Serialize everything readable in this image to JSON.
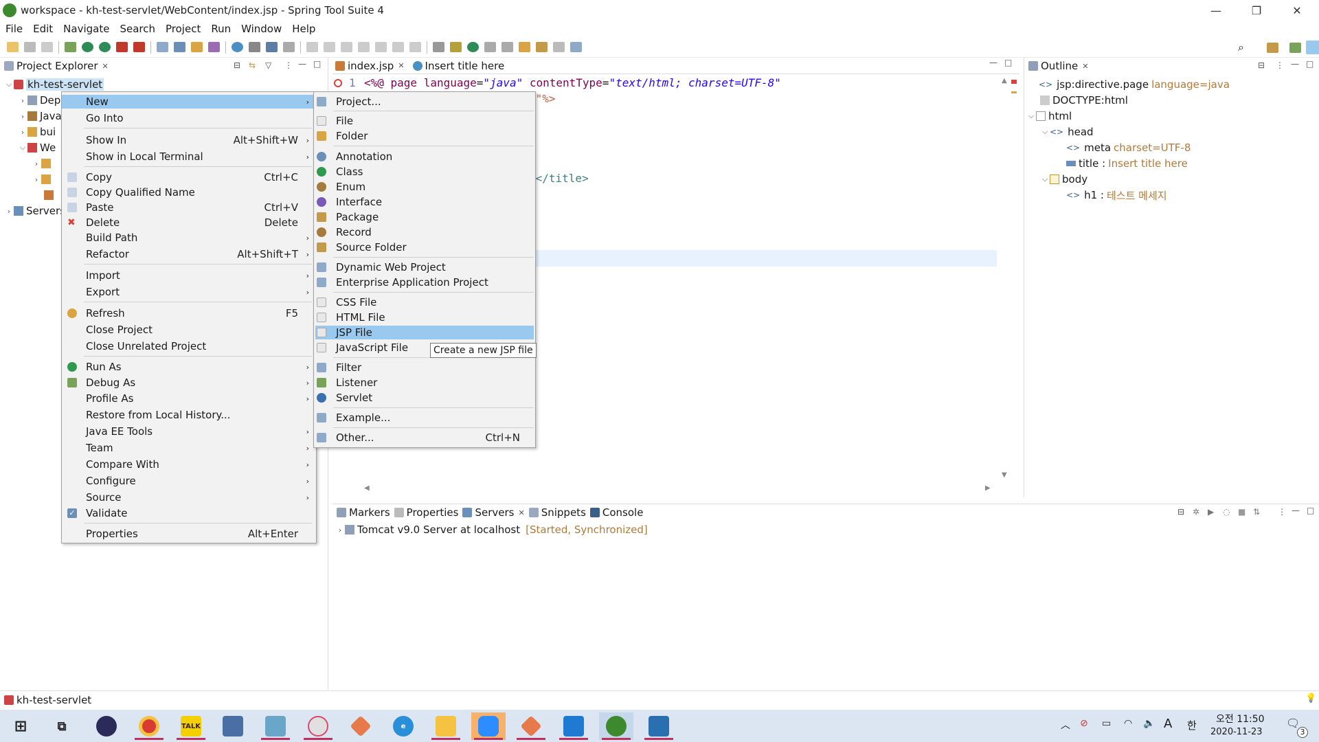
{
  "window": {
    "title": "workspace - kh-test-servlet/WebContent/index.jsp - Spring Tool Suite 4",
    "minimize": "—",
    "restore": "❐",
    "close": "✕"
  },
  "menubar": [
    "File",
    "Edit",
    "Navigate",
    "Search",
    "Project",
    "Run",
    "Window",
    "Help"
  ],
  "project_explorer": {
    "title": "Project Explorer",
    "project": "kh-test-servlet",
    "children": [
      "Dep",
      "Java",
      "bui",
      "We"
    ],
    "we_children": [
      "",
      "",
      ""
    ],
    "servers": "Servers"
  },
  "editor": {
    "tabs": [
      {
        "label": "index.jsp"
      },
      {
        "label": "Insert title here"
      }
    ],
    "line1_num": "1",
    "line1_a": "<%@ ",
    "line1_b": "page ",
    "line1_c": "language",
    "line1_d": "=",
    "line1_e": "\"java\"",
    "line1_f": " contentType",
    "line1_g": "=",
    "line1_h": "\"text/html; charset=UTF-8\"",
    "line2_tail": "8\"%>",
    "line_title_tail": "e</title>"
  },
  "outline": {
    "title": "Outline",
    "items": [
      {
        "label": "jsp:directive.page",
        "extra": "language=java"
      },
      {
        "label": "DOCTYPE:html",
        "extra": ""
      },
      {
        "label": "html",
        "extra": ""
      },
      {
        "label": "head",
        "extra": ""
      },
      {
        "label": "meta",
        "extra": "charset=UTF-8"
      },
      {
        "label": "title :",
        "extra": "Insert title here"
      },
      {
        "label": "body",
        "extra": ""
      },
      {
        "label": "h1 :",
        "extra": "테스트 메세지"
      }
    ]
  },
  "context_menu": {
    "items": [
      {
        "label": "New",
        "acc": "",
        "submenu": true
      },
      {
        "label": "Go Into",
        "acc": ""
      },
      {
        "label": "Show In",
        "acc": "Alt+Shift+W",
        "submenu": true
      },
      {
        "label": "Show in Local Terminal",
        "acc": "",
        "submenu": true
      },
      {
        "label": "Copy",
        "acc": "Ctrl+C"
      },
      {
        "label": "Copy Qualified Name",
        "acc": ""
      },
      {
        "label": "Paste",
        "acc": "Ctrl+V"
      },
      {
        "label": "Delete",
        "acc": "Delete"
      },
      {
        "label": "Build Path",
        "acc": "",
        "submenu": true
      },
      {
        "label": "Refactor",
        "acc": "Alt+Shift+T",
        "submenu": true
      },
      {
        "label": "Import",
        "acc": "",
        "submenu": true
      },
      {
        "label": "Export",
        "acc": "",
        "submenu": true
      },
      {
        "label": "Refresh",
        "acc": "F5"
      },
      {
        "label": "Close Project",
        "acc": ""
      },
      {
        "label": "Close Unrelated Project",
        "acc": ""
      },
      {
        "label": "Run As",
        "acc": "",
        "submenu": true
      },
      {
        "label": "Debug As",
        "acc": "",
        "submenu": true
      },
      {
        "label": "Profile As",
        "acc": "",
        "submenu": true
      },
      {
        "label": "Restore from Local History...",
        "acc": ""
      },
      {
        "label": "Java EE Tools",
        "acc": "",
        "submenu": true
      },
      {
        "label": "Team",
        "acc": "",
        "submenu": true
      },
      {
        "label": "Compare With",
        "acc": "",
        "submenu": true
      },
      {
        "label": "Configure",
        "acc": "",
        "submenu": true
      },
      {
        "label": "Source",
        "acc": "",
        "submenu": true
      },
      {
        "label": "Validate",
        "acc": ""
      },
      {
        "label": "Properties",
        "acc": "Alt+Enter"
      }
    ]
  },
  "new_submenu": {
    "items": [
      {
        "label": "Project..."
      },
      {
        "label": "File"
      },
      {
        "label": "Folder"
      },
      {
        "label": "Annotation"
      },
      {
        "label": "Class"
      },
      {
        "label": "Enum"
      },
      {
        "label": "Interface"
      },
      {
        "label": "Package"
      },
      {
        "label": "Record"
      },
      {
        "label": "Source Folder"
      },
      {
        "label": "Dynamic Web Project"
      },
      {
        "label": "Enterprise Application Project"
      },
      {
        "label": "CSS File"
      },
      {
        "label": "HTML File"
      },
      {
        "label": "JSP File"
      },
      {
        "label": "JavaScript File"
      },
      {
        "label": "Filter"
      },
      {
        "label": "Listener"
      },
      {
        "label": "Servlet"
      },
      {
        "label": "Example..."
      },
      {
        "label": "Other...",
        "acc": "Ctrl+N"
      }
    ],
    "tooltip": "Create a new JSP file"
  },
  "bottom_panel": {
    "tabs": [
      "Markers",
      "Properties",
      "Servers",
      "Snippets",
      "Console"
    ],
    "server_name": "Tomcat v9.0 Server at localhost",
    "server_state": "[Started, Synchronized]"
  },
  "statusbar": {
    "text": "kh-test-servlet"
  },
  "taskbar": {
    "time": "오전 11:50",
    "date": "2020-11-23",
    "ime": "A",
    "lang": "한",
    "notif_count": "3"
  },
  "colors": {
    "menu_selected": "#99c9ef",
    "taskbar_bg": "#dbe6f2",
    "accent_underline": "#c0305a",
    "decorator_orange": "#b07a3a"
  }
}
